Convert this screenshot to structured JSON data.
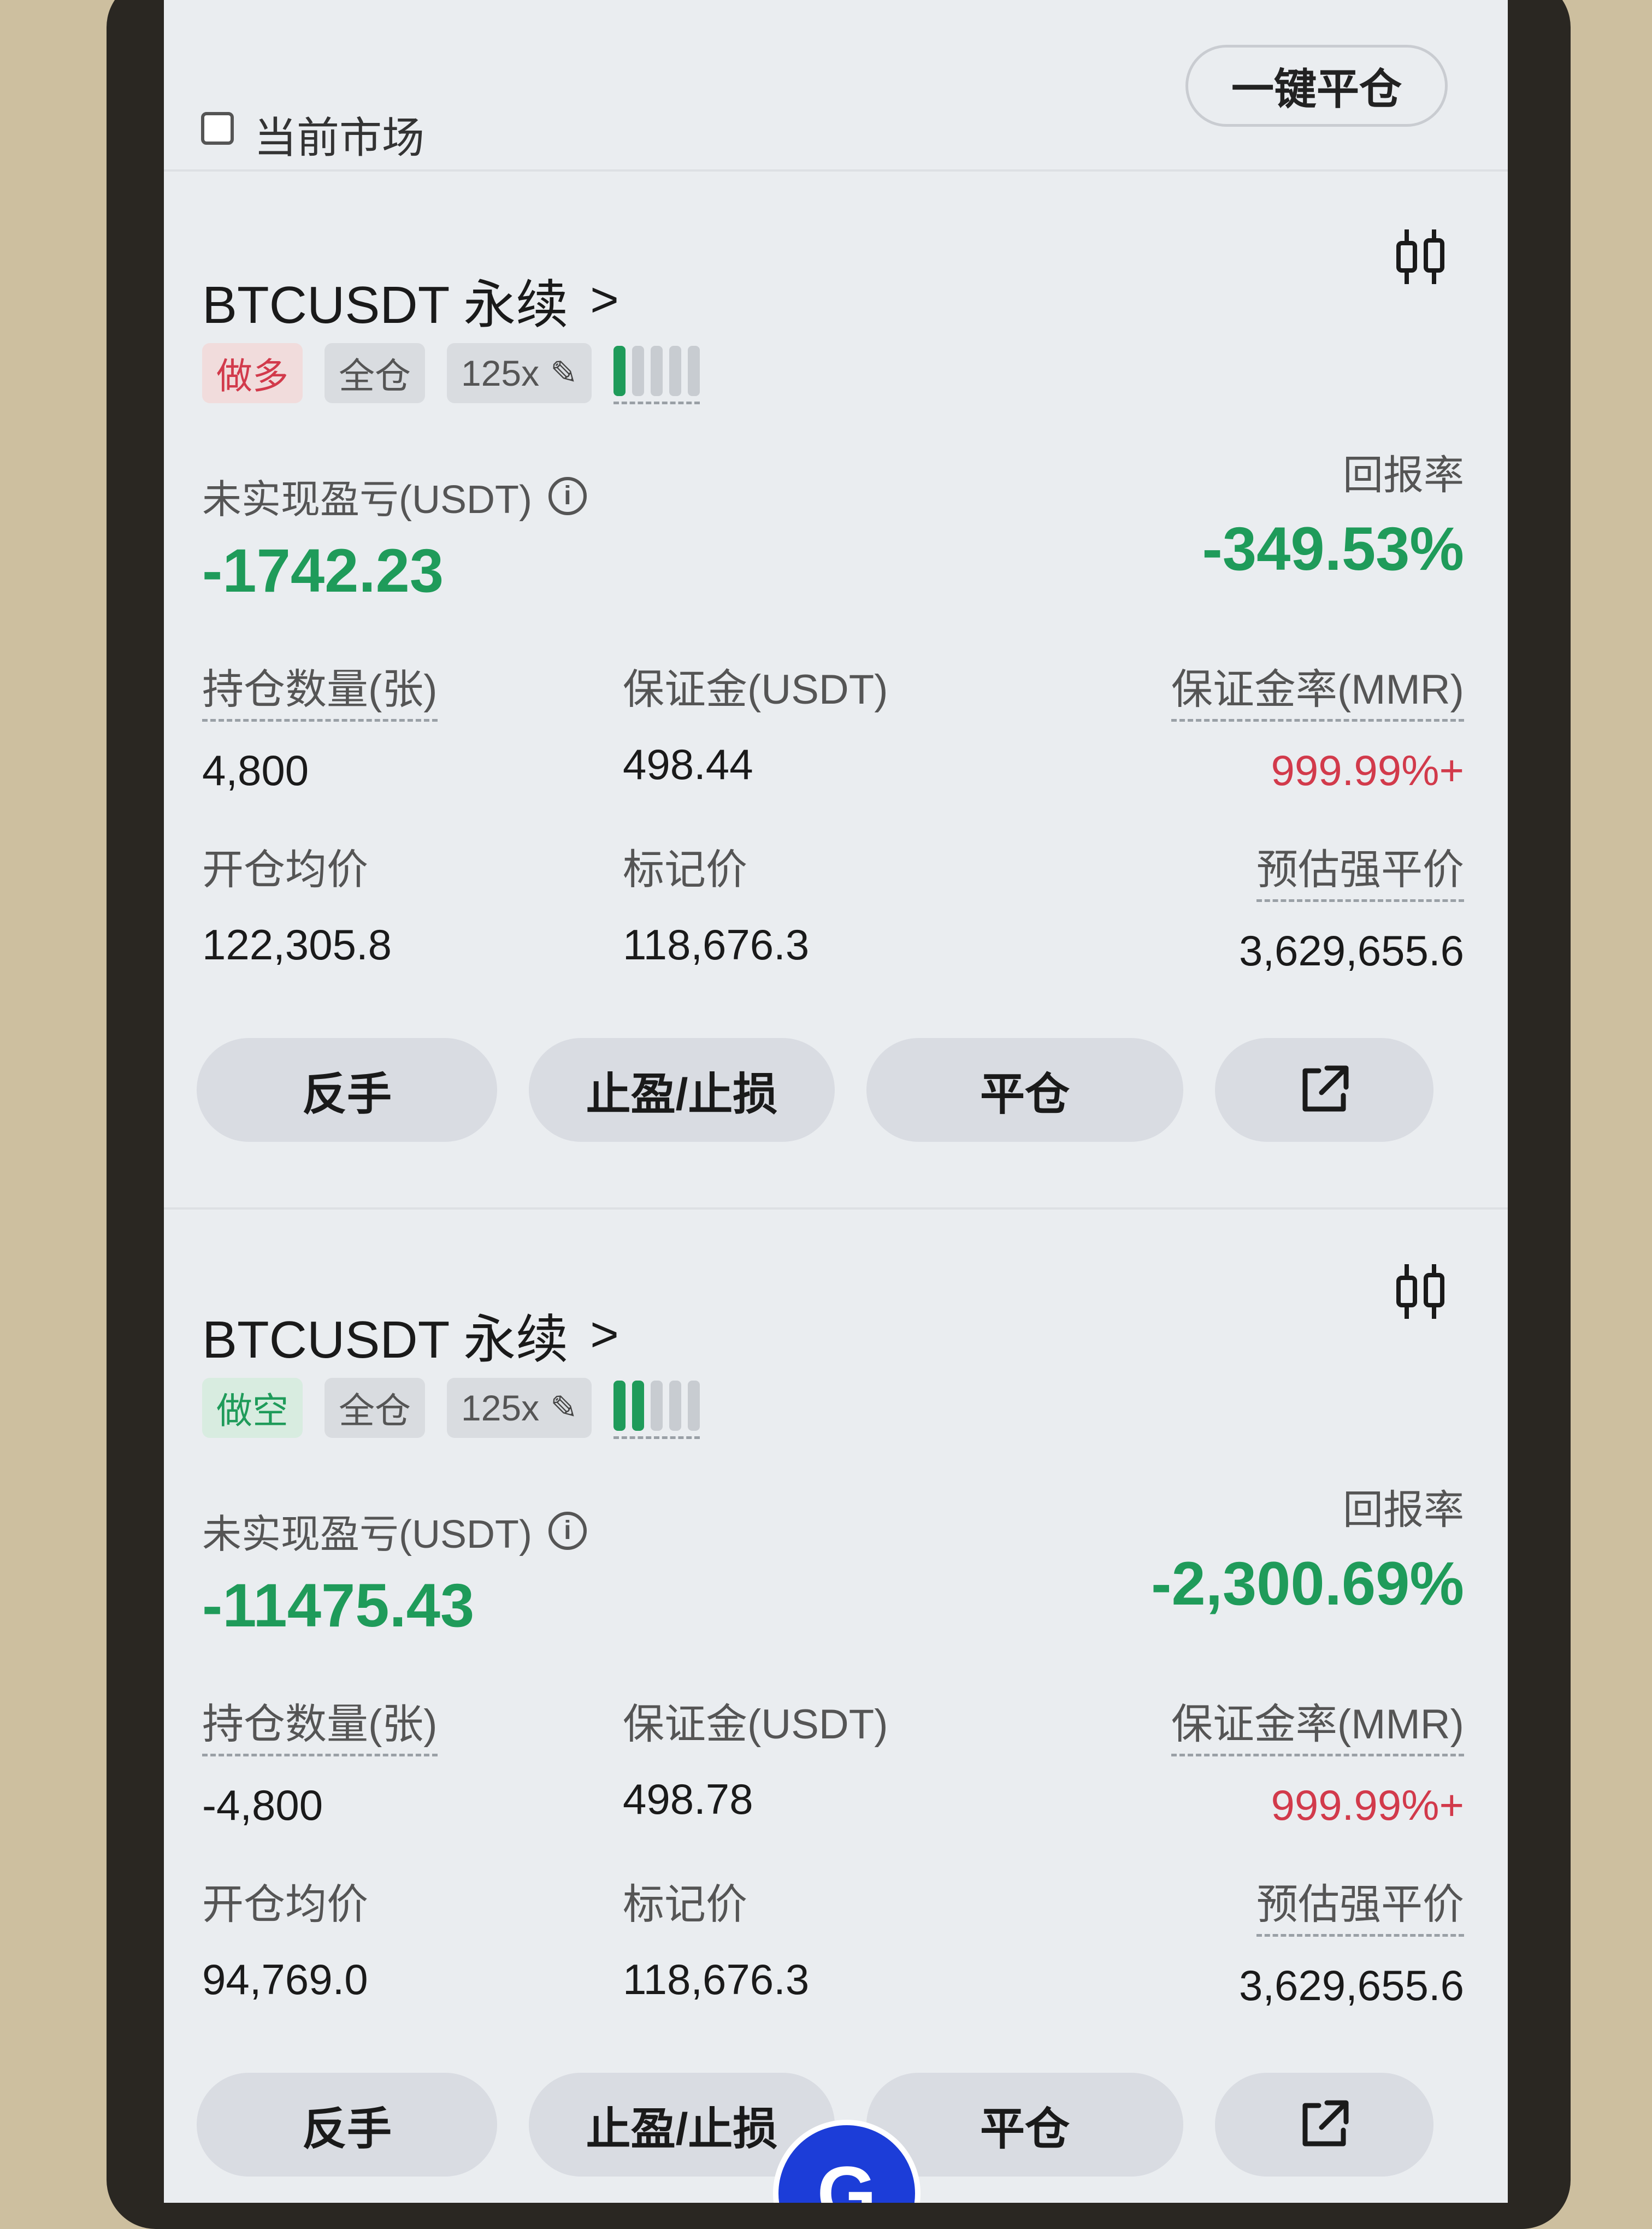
{
  "header": {
    "current_market_label": "当前市场",
    "close_all_label": "一键平仓"
  },
  "positions": [
    {
      "symbol": "BTCUSDT 永续",
      "side": "做多",
      "margin_mode": "全仓",
      "leverage": "125x",
      "risk_level_bars_filled": 1,
      "pnl_label": "未实现盈亏(USDT)",
      "pnl_value": "-1742.23",
      "roe_label": "回报率",
      "roe_value": "-349.53%",
      "size_label": "持仓数量(张)",
      "size_value": "4,800",
      "margin_label": "保证金(USDT)",
      "margin_value": "498.44",
      "mmr_label": "保证金率(MMR)",
      "mmr_value": "999.99%+",
      "entry_label": "开仓均价",
      "entry_value": "122,305.8",
      "mark_label": "标记价",
      "mark_value": "118,676.3",
      "liq_label": "预估强平价",
      "liq_value": "3,629,655.6",
      "actions": {
        "reverse": "反手",
        "tpsl": "止盈/止损",
        "close": "平仓"
      }
    },
    {
      "symbol": "BTCUSDT 永续",
      "side": "做空",
      "margin_mode": "全仓",
      "leverage": "125x",
      "risk_level_bars_filled": 2,
      "pnl_label": "未实现盈亏(USDT)",
      "pnl_value": "-11475.43",
      "roe_label": "回报率",
      "roe_value": "-2,300.69%",
      "size_label": "持仓数量(张)",
      "size_value": "-4,800",
      "margin_label": "保证金(USDT)",
      "margin_value": "498.78",
      "mmr_label": "保证金率(MMR)",
      "mmr_value": "999.99%+",
      "entry_label": "开仓均价",
      "entry_value": "94,769.0",
      "mark_label": "标记价",
      "mark_value": "118,676.3",
      "liq_label": "预估强平价",
      "liq_value": "3,629,655.6",
      "actions": {
        "reverse": "反手",
        "tpsl": "止盈/止损",
        "close": "平仓"
      }
    }
  ],
  "colors": {
    "profit_green": "#1f9b5a",
    "loss_red": "#d23a4b",
    "brand_blue": "#1c3dd8"
  },
  "icons": [
    "info-icon",
    "candlestick-icon",
    "share-icon",
    "edit-icon",
    "chevron-right-icon"
  ]
}
